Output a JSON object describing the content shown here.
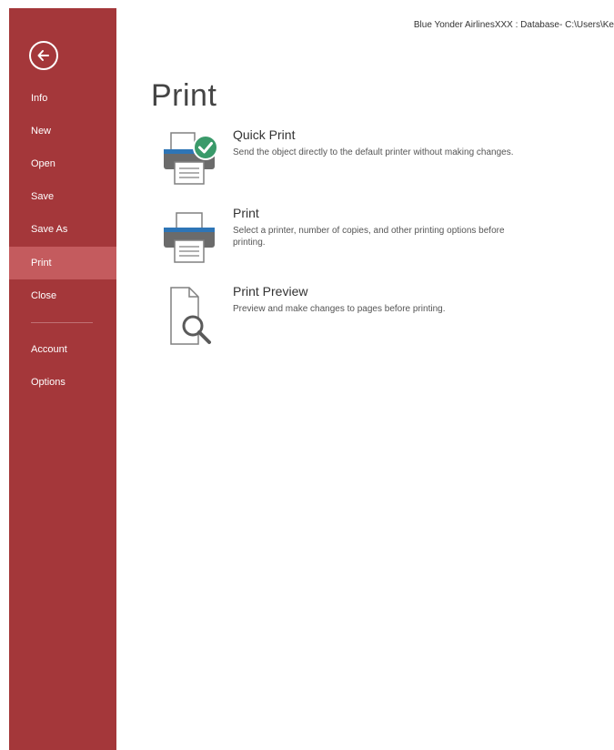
{
  "window": {
    "title": "Blue Yonder AirlinesXXX : Database- C:\\Users\\Ke"
  },
  "sidebar": {
    "items": [
      {
        "label": "Info"
      },
      {
        "label": "New"
      },
      {
        "label": "Open"
      },
      {
        "label": "Save"
      },
      {
        "label": "Save As"
      },
      {
        "label": "Print",
        "selected": true
      },
      {
        "label": "Close"
      },
      {
        "label": "Account"
      },
      {
        "label": "Options"
      }
    ]
  },
  "main": {
    "title": "Print",
    "options": [
      {
        "title": "Quick Print",
        "description": "Send the object directly to the default printer without making changes.",
        "icon": "printer-check-icon"
      },
      {
        "title": "Print",
        "description": "Select a printer, number of copies, and other printing options before printing.",
        "icon": "printer-icon"
      },
      {
        "title": "Print Preview",
        "description": "Preview and make changes to pages before printing.",
        "icon": "print-preview-icon"
      }
    ]
  },
  "colors": {
    "sidebar": "#a4373a",
    "selected": "#c45b5e",
    "check": "#3a9a6a",
    "printer_accent": "#2e75b6"
  }
}
